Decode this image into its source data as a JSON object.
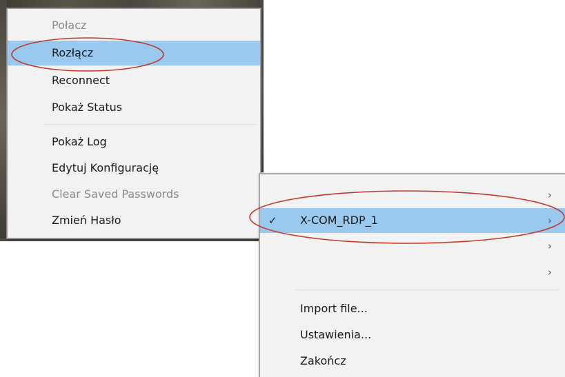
{
  "left_menu": {
    "items": [
      {
        "label": "Połacz",
        "disabled": true
      },
      {
        "label": "Rozłącz",
        "highlight": true
      },
      {
        "label": "Reconnect"
      },
      {
        "label": "Pokaż Status"
      },
      {
        "label": "Pokaż Log"
      },
      {
        "label": "Edytuj Konfigurację"
      },
      {
        "label": "Clear Saved Passwords",
        "disabled": true
      },
      {
        "label": "Zmień Hasło"
      }
    ]
  },
  "right_menu": {
    "connections": [
      {
        "label": "",
        "checked": false,
        "submenu": true
      },
      {
        "label": "X-COM_RDP_1",
        "checked": true,
        "submenu": true,
        "highlight": true
      },
      {
        "label": "",
        "checked": false,
        "submenu": true
      },
      {
        "label": "",
        "checked": false,
        "submenu": true
      }
    ],
    "actions": [
      {
        "label": "Import file..."
      },
      {
        "label": "Ustawienia..."
      },
      {
        "label": "Zakończ"
      }
    ],
    "check_glyph": "✓",
    "chevron_glyph": "›"
  },
  "colors": {
    "highlight": "#99c9ef",
    "menu_bg": "#f2f2f2",
    "annotation": "#c0392b"
  },
  "icons": {
    "check": "checkmark-icon",
    "chevron": "chevron-right-icon"
  }
}
